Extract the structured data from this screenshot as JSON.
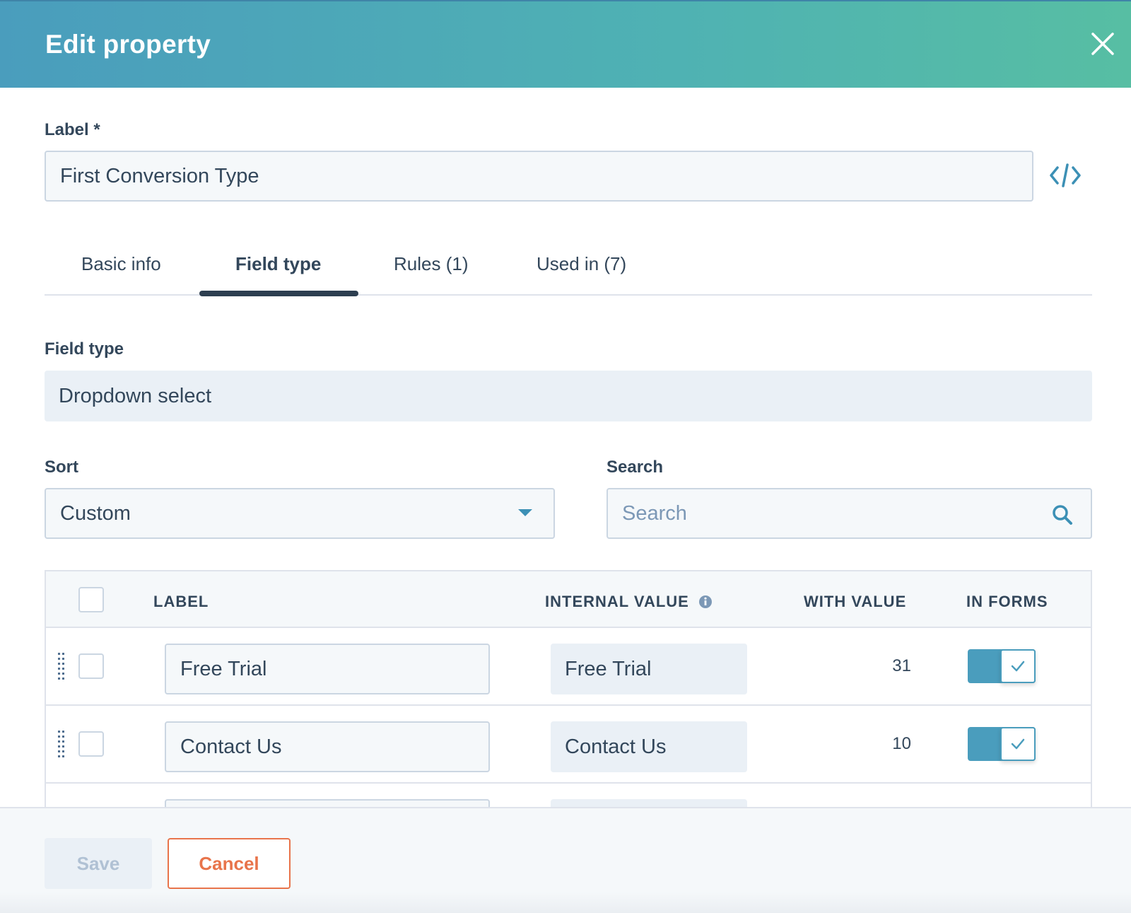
{
  "header": {
    "title": "Edit property"
  },
  "label_field": {
    "label": "Label *",
    "value": "First Conversion Type"
  },
  "tabs": [
    {
      "label": "Basic info",
      "active": false
    },
    {
      "label": "Field type",
      "active": true
    },
    {
      "label": "Rules (1)",
      "active": false
    },
    {
      "label": "Used in (7)",
      "active": false
    }
  ],
  "field_type": {
    "label": "Field type",
    "value": "Dropdown select"
  },
  "sort": {
    "label": "Sort",
    "value": "Custom"
  },
  "search": {
    "label": "Search",
    "placeholder": "Search"
  },
  "table": {
    "columns": {
      "label": "LABEL",
      "internal_value": "INTERNAL VALUE",
      "with_value": "WITH VALUE",
      "in_forms": "IN FORMS"
    },
    "rows": [
      {
        "label": "Free Trial",
        "internal_value": "Free Trial",
        "with_value": "31",
        "in_forms": true
      },
      {
        "label": "Contact Us",
        "internal_value": "Contact Us",
        "with_value": "10",
        "in_forms": true
      }
    ]
  },
  "footer": {
    "save_label": "Save",
    "cancel_label": "Cancel"
  },
  "colors": {
    "header_start": "#4a9dbd",
    "header_end": "#57bea3",
    "accent": "#4a9dbd",
    "cancel": "#e8744b",
    "text": "#33475b"
  },
  "icons": {
    "close": "close-icon",
    "code": "code-icon",
    "dropdown": "chevron-down-icon",
    "search": "search-icon",
    "info": "info-icon",
    "drag": "drag-handle-icon",
    "check": "check-icon"
  }
}
